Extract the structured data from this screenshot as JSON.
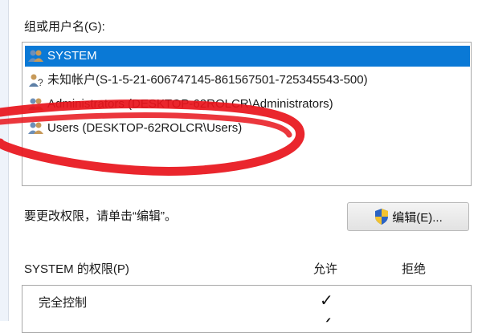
{
  "group_section": {
    "label": "组或用户名(G):",
    "items": [
      {
        "label": "SYSTEM",
        "icon": "users-group-icon",
        "selected": true
      },
      {
        "label": "未知帐户(S-1-5-21-606747145-861567501-725345543-500)",
        "icon": "unknown-user-icon",
        "selected": false
      },
      {
        "label": "Administrators (DESKTOP-62ROLCR\\Administrators)",
        "icon": "users-group-icon",
        "selected": false
      },
      {
        "label": "Users (DESKTOP-62ROLCR\\Users)",
        "icon": "users-group-icon",
        "selected": false
      }
    ]
  },
  "hint": "要更改权限，请单击“编辑”。",
  "edit_button": {
    "label": "编辑(E)...",
    "icon": "uac-shield-icon"
  },
  "permissions": {
    "title": "SYSTEM 的权限(P)",
    "allow_header": "允许",
    "deny_header": "拒绝",
    "rows": [
      {
        "label": "完全控制",
        "allow": "✓",
        "deny": ""
      }
    ]
  },
  "colors": {
    "selection": "#0a79d6",
    "annotation_red": "#e8141b"
  }
}
